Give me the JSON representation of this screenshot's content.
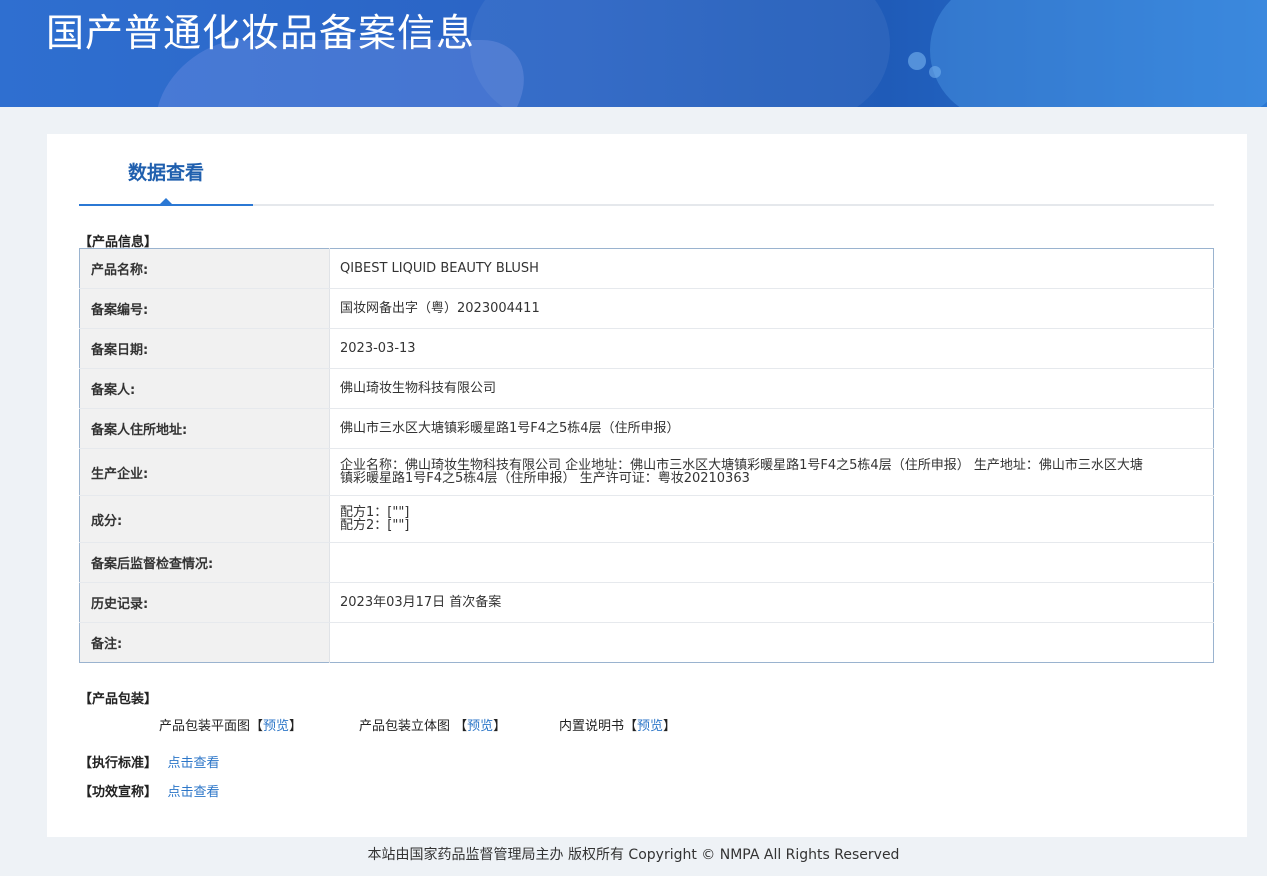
{
  "header": {
    "title": "国产普通化妆品备案信息"
  },
  "tabs": {
    "active_label": "数据查看"
  },
  "sections": {
    "product_info": "【产品信息】",
    "packaging": "【产品包装】",
    "standard": "【执行标准】",
    "efficacy": "【功效宣称】"
  },
  "product_info_rows": [
    {
      "label": "产品名称:",
      "value": "QIBEST LIQUID BEAUTY BLUSH"
    },
    {
      "label": "备案编号:",
      "value": "国妆网备出字（粤）2023004411"
    },
    {
      "label": "备案日期:",
      "value": "2023-03-13"
    },
    {
      "label": "备案人:",
      "value": "佛山琦妆生物科技有限公司"
    },
    {
      "label": "备案人住所地址:",
      "value": "佛山市三水区大塘镇彩暖星路1号F4之5栋4层（住所申报）"
    },
    {
      "label": "生产企业:",
      "value": "企业名称：佛山琦妆生物科技有限公司 企业地址：佛山市三水区大塘镇彩暖星路1号F4之5栋4层（住所申报） 生产地址：佛山市三水区大塘镇彩暖星路1号F4之5栋4层（住所申报） 生产许可证：粤妆20210363"
    },
    {
      "label": "成分:",
      "value_lines": [
        "配方1：[\"\"]",
        "配方2：[\"\"]"
      ]
    },
    {
      "label": "备案后监督检查情况:",
      "value": ""
    },
    {
      "label": "历史记录:",
      "value": "2023年03月17日 首次备案"
    },
    {
      "label": "备注:",
      "value": ""
    }
  ],
  "packaging": {
    "flat_label": "产品包装平面图",
    "three_d_label": "产品包装立体图 ",
    "manual_label": "内置说明书",
    "bracket_open": "【",
    "bracket_close": "】",
    "preview_link": "预览"
  },
  "standard_link": "点击查看",
  "efficacy_link": "点击查看",
  "footer": {
    "text": "本站由国家药品监督管理局主办 版权所有 Copyright © NMPA All Rights Reserved"
  }
}
